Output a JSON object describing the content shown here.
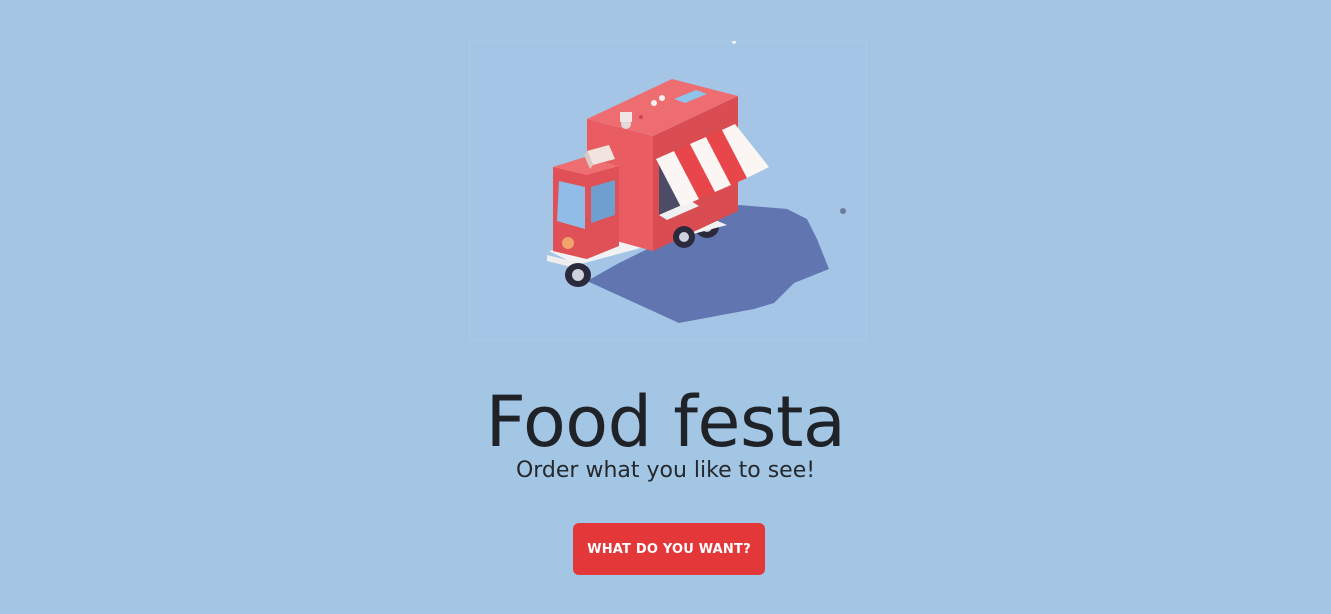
{
  "hero": {
    "image_icon": "food-truck-illustration",
    "title": "Food festa",
    "subtitle": "Order what you like to see!",
    "cta_label": "WHAT DO YOU WANT?"
  },
  "colors": {
    "background": "#a2c6e4",
    "truck_body": "#e85a5e",
    "awning_red": "#e8464b",
    "button": "#e3373a",
    "title_text": "#1f2328"
  }
}
